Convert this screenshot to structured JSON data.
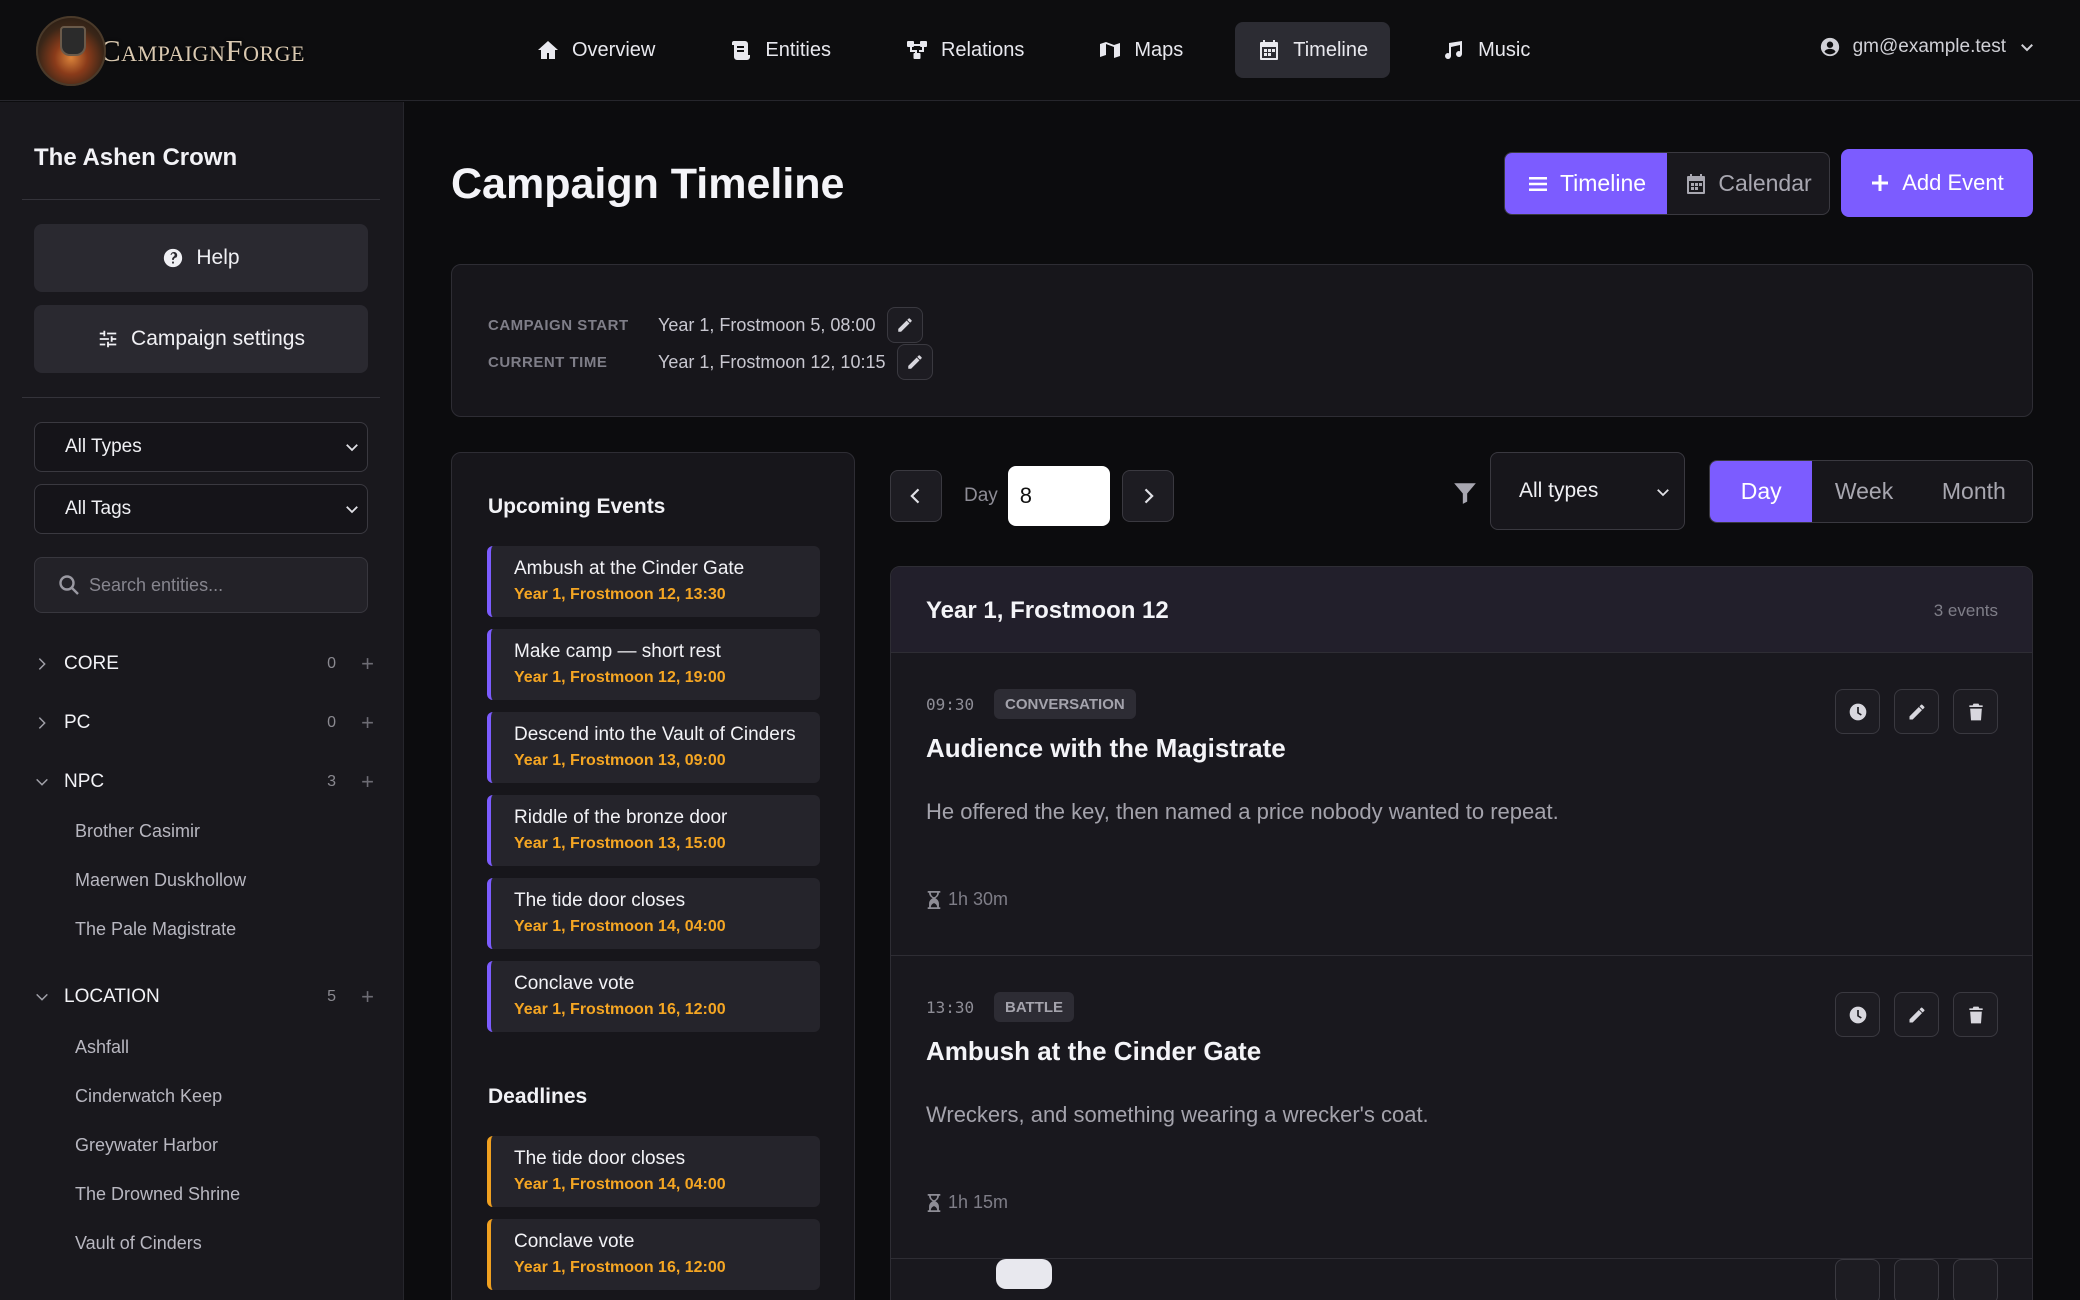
{
  "app": {
    "logo_text": "CampaignForge",
    "user_email": "gm@example.test"
  },
  "nav": [
    {
      "label": "Overview",
      "icon": "home-icon"
    },
    {
      "label": "Entities",
      "icon": "scroll-icon"
    },
    {
      "label": "Relations",
      "icon": "relations-icon"
    },
    {
      "label": "Maps",
      "icon": "map-icon"
    },
    {
      "label": "Timeline",
      "icon": "calendar-icon",
      "active": true
    },
    {
      "label": "Music",
      "icon": "music-icon"
    }
  ],
  "sidebar": {
    "campaign_name": "The Ashen Crown",
    "help_label": "Help",
    "settings_label": "Campaign settings",
    "type_filter": "All Types",
    "tag_filter": "All Tags",
    "search_placeholder": "Search entities...",
    "categories": [
      {
        "name": "CORE",
        "count": "0",
        "expanded": false,
        "items": []
      },
      {
        "name": "PC",
        "count": "0",
        "expanded": false,
        "items": []
      },
      {
        "name": "NPC",
        "count": "3",
        "expanded": true,
        "items": [
          "Brother Casimir",
          "Maerwen Duskhollow",
          "The Pale Magistrate"
        ]
      },
      {
        "name": "LOCATION",
        "count": "5",
        "expanded": true,
        "items": [
          "Ashfall",
          "Cinderwatch Keep",
          "Greywater Harbor",
          "The Drowned Shrine",
          "Vault of Cinders"
        ]
      }
    ]
  },
  "main": {
    "title": "Campaign Timeline",
    "view_timeline": "Timeline",
    "view_calendar": "Calendar",
    "add_event": "Add Event",
    "campaign_start_label": "CAMPAIGN START",
    "campaign_start_value": "Year 1, Frostmoon 5, 08:00",
    "current_time_label": "CURRENT TIME",
    "current_time_value": "Year 1, Frostmoon 12, 10:15"
  },
  "upcoming": {
    "heading": "Upcoming Events",
    "events": [
      {
        "title": "Ambush at the Cinder Gate",
        "date": "Year 1, Frostmoon 12, 13:30"
      },
      {
        "title": "Make camp — short rest",
        "date": "Year 1, Frostmoon 12, 19:00"
      },
      {
        "title": "Descend into the Vault of Cinders",
        "date": "Year 1, Frostmoon 13, 09:00"
      },
      {
        "title": "Riddle of the bronze door",
        "date": "Year 1, Frostmoon 13, 15:00"
      },
      {
        "title": "The tide door closes",
        "date": "Year 1, Frostmoon 14, 04:00"
      },
      {
        "title": "Conclave vote",
        "date": "Year 1, Frostmoon 16, 12:00"
      }
    ],
    "deadlines_heading": "Deadlines",
    "deadlines": [
      {
        "title": "The tide door closes",
        "date": "Year 1, Frostmoon 14, 04:00"
      },
      {
        "title": "Conclave vote",
        "date": "Year 1, Frostmoon 16, 12:00"
      }
    ]
  },
  "day_controls": {
    "day_label": "Day",
    "day_value": "8",
    "type_filter": "All types",
    "views": [
      "Day",
      "Week",
      "Month"
    ],
    "active_view": "Day"
  },
  "day_panel": {
    "date": "Year 1, Frostmoon 12",
    "count": "3 events",
    "events": [
      {
        "time": "09:30",
        "tag": "CONVERSATION",
        "title": "Audience with the Magistrate",
        "desc": "He offered the key, then named a price nobody wanted to repeat.",
        "duration": "1h 30m"
      },
      {
        "time": "13:30",
        "tag": "BATTLE",
        "title": "Ambush at the Cinder Gate",
        "desc": "Wreckers, and something wearing a wrecker's coat.",
        "duration": "1h 15m"
      }
    ]
  },
  "colors": {
    "accent": "#7c5cff",
    "deadline": "#f0a020",
    "date_text": "#f5a623"
  }
}
